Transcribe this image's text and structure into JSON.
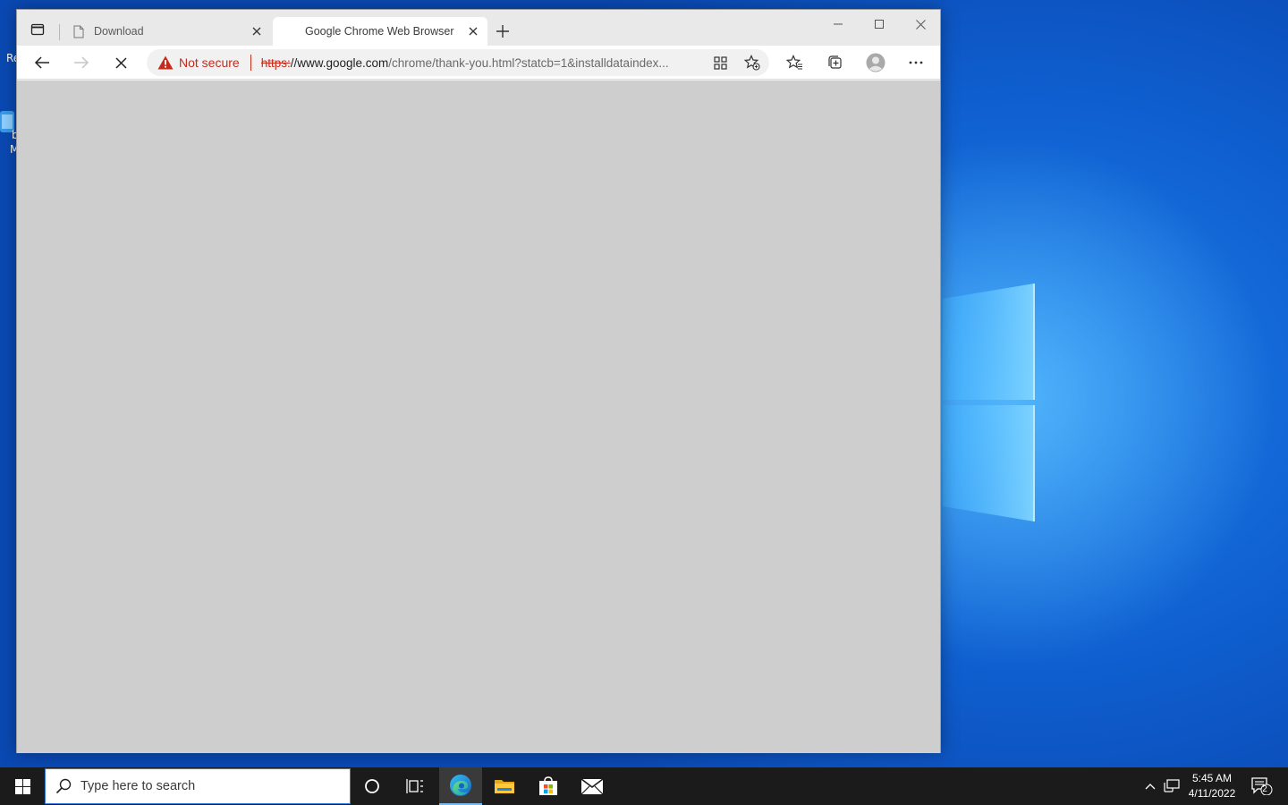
{
  "desktop": {
    "icon_fragments": [
      "Re",
      "b",
      "M"
    ]
  },
  "browser": {
    "tabs": [
      {
        "title": "Download",
        "active": false
      },
      {
        "title": "Google Chrome Web Browser",
        "active": true
      }
    ],
    "address": {
      "security_label": "Not secure",
      "url_scheme": "https:",
      "url_host": "//www.google.com",
      "url_path": "/chrome/thank-you.html?statcb=1&installdataindex..."
    },
    "content_background": "#cecece"
  },
  "taskbar": {
    "search_placeholder": "Type here to search",
    "time": "5:45 AM",
    "date": "4/11/2022",
    "notification_count": "2"
  },
  "colors": {
    "warning_red": "#c42b1c",
    "taskbar": "#1b1b1b",
    "accent": "#76b9ed"
  }
}
